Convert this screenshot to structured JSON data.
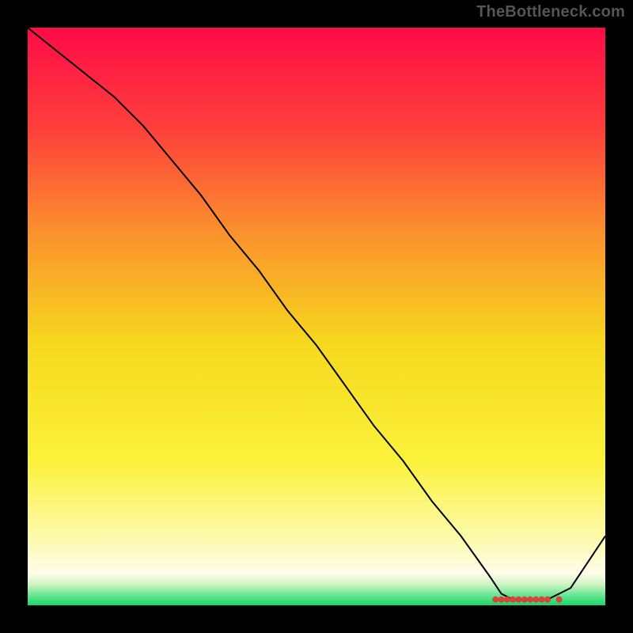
{
  "watermark": "TheBottleneck.com",
  "chart_data": {
    "type": "line",
    "title": "",
    "xlabel": "",
    "ylabel": "",
    "xlim": [
      0,
      100
    ],
    "ylim": [
      0,
      100
    ],
    "x": [
      0,
      5,
      10,
      15,
      20,
      25,
      30,
      35,
      40,
      45,
      50,
      55,
      60,
      65,
      70,
      75,
      80,
      82,
      84,
      86,
      88,
      90,
      92,
      94,
      100
    ],
    "values": [
      100,
      96,
      92,
      88,
      83,
      77,
      71,
      64,
      58,
      51,
      45,
      38,
      31,
      25,
      18,
      12,
      5,
      2,
      1,
      1,
      1,
      1,
      2,
      3,
      12
    ],
    "markers_x": [
      81,
      82,
      83,
      84,
      85,
      86,
      87,
      88,
      89,
      90,
      92
    ],
    "markers_y": [
      1,
      1,
      1,
      1,
      1,
      1,
      1,
      1,
      1,
      1,
      1
    ],
    "background_gradient_stops": [
      {
        "offset": 0.0,
        "color": "#ff0b47"
      },
      {
        "offset": 0.18,
        "color": "#fd413b"
      },
      {
        "offset": 0.35,
        "color": "#fb8f2d"
      },
      {
        "offset": 0.55,
        "color": "#f6d91e"
      },
      {
        "offset": 0.75,
        "color": "#fbf23a"
      },
      {
        "offset": 0.88,
        "color": "#fcfaa9"
      },
      {
        "offset": 0.945,
        "color": "#fefde9"
      },
      {
        "offset": 0.965,
        "color": "#c8f4be"
      },
      {
        "offset": 0.985,
        "color": "#5be38e"
      },
      {
        "offset": 1.0,
        "color": "#17d867"
      }
    ],
    "line_color": "#000000",
    "marker_color": "#d9433d"
  }
}
